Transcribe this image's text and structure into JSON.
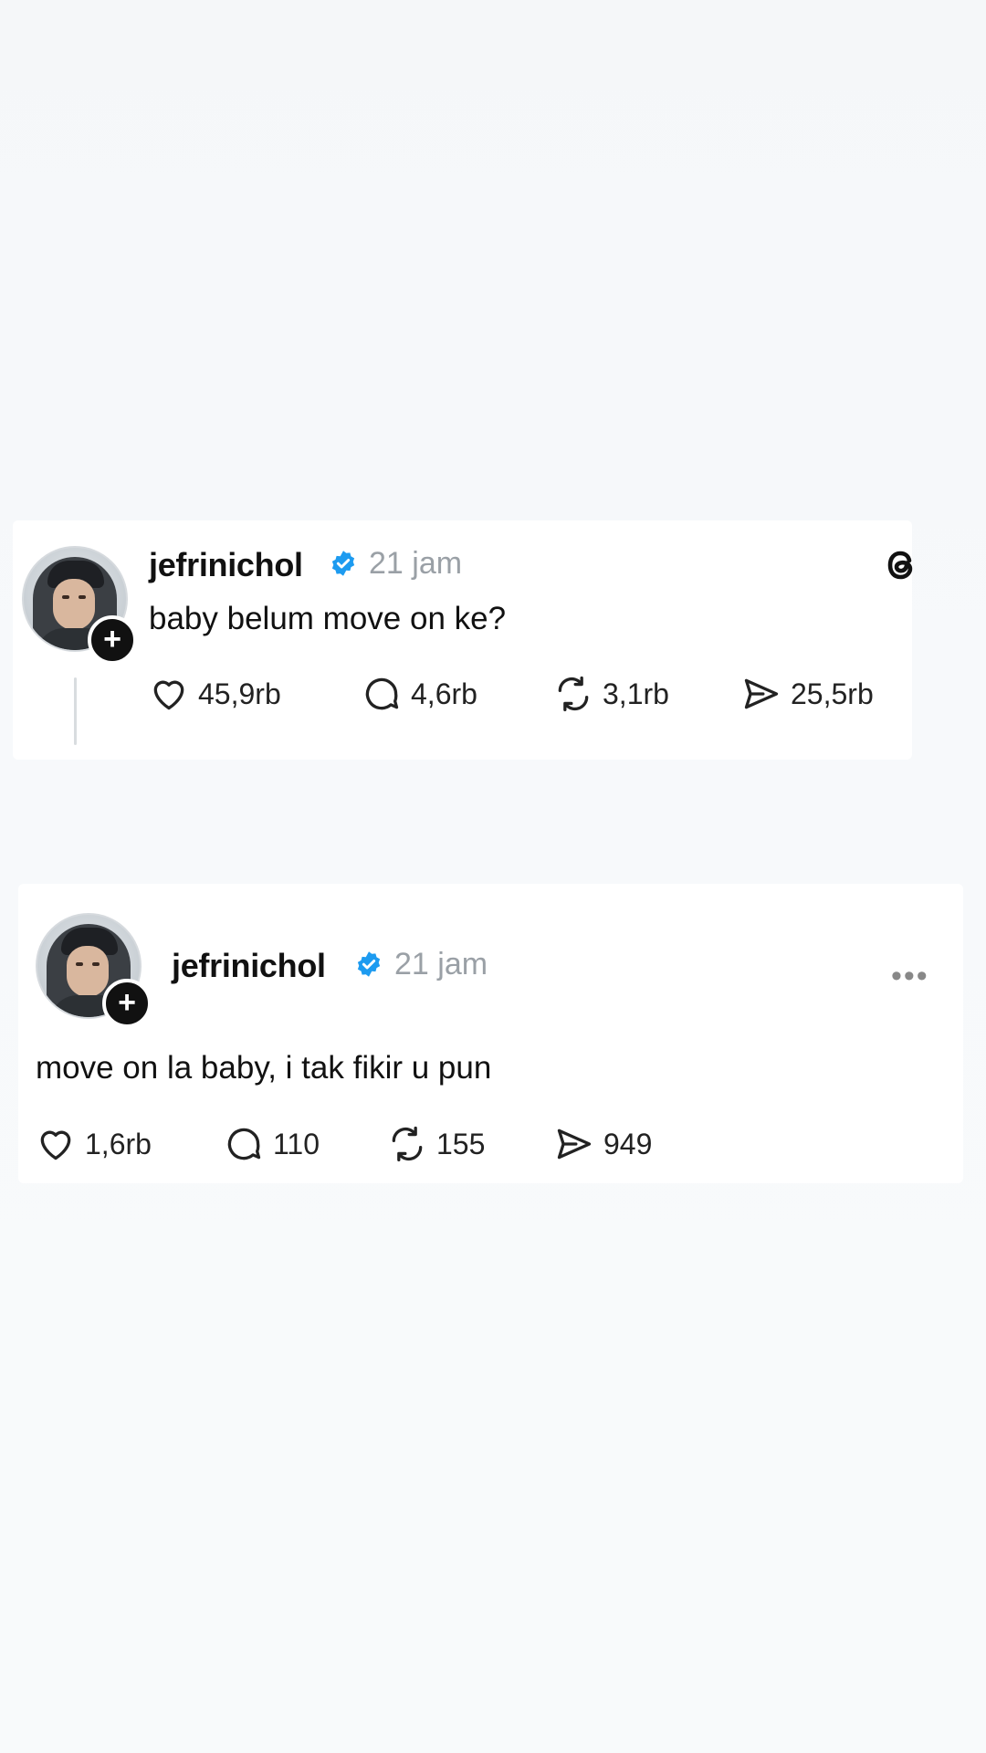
{
  "posts": [
    {
      "username": "jefrinichol",
      "time": "21 jam",
      "text": "baby belum move on ke?",
      "actions": {
        "likes": "45,9rb",
        "replies": "4,6rb",
        "reposts": "3,1rb",
        "shares": "25,5rb"
      }
    },
    {
      "username": "jefrinichol",
      "time": "21 jam",
      "text": "move on la baby, i tak fikir u pun",
      "actions": {
        "likes": "1,6rb",
        "replies": "110",
        "reposts": "155",
        "shares": "949"
      }
    }
  ],
  "icons": {
    "verified": "verified-badge-icon",
    "app_logo": "threads-logo-icon",
    "like": "heart-icon",
    "reply": "comment-bubble-icon",
    "repost": "repost-icon",
    "share": "send-icon",
    "follow": "plus-icon",
    "more": "more-dots-icon"
  },
  "colors": {
    "verified": "#1d9bf0",
    "text": "#111111",
    "muted": "#9aa0a6"
  }
}
